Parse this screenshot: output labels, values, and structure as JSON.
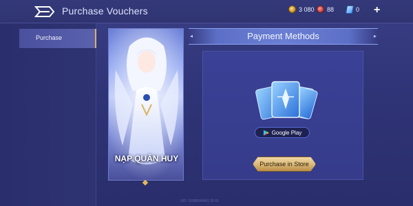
{
  "header": {
    "title": "Purchase Vouchers",
    "gold": "3 080",
    "gems": "88",
    "vouchers": "0",
    "add_label": "+"
  },
  "sidebar": {
    "items": [
      {
        "label": "Purchase",
        "selected": true
      }
    ]
  },
  "banner": {
    "text": "NẠP QUÂN HUY"
  },
  "main": {
    "section_title": "Payment Methods",
    "google_play_label": "Google Play",
    "store_button_label": "Purchase in Store"
  },
  "footer": {
    "uid_text": "UID: 10080049491 30 01"
  },
  "colors": {
    "accent_gold": "#d6b46a",
    "background": "#2f3477",
    "panel": "#3a4196"
  }
}
